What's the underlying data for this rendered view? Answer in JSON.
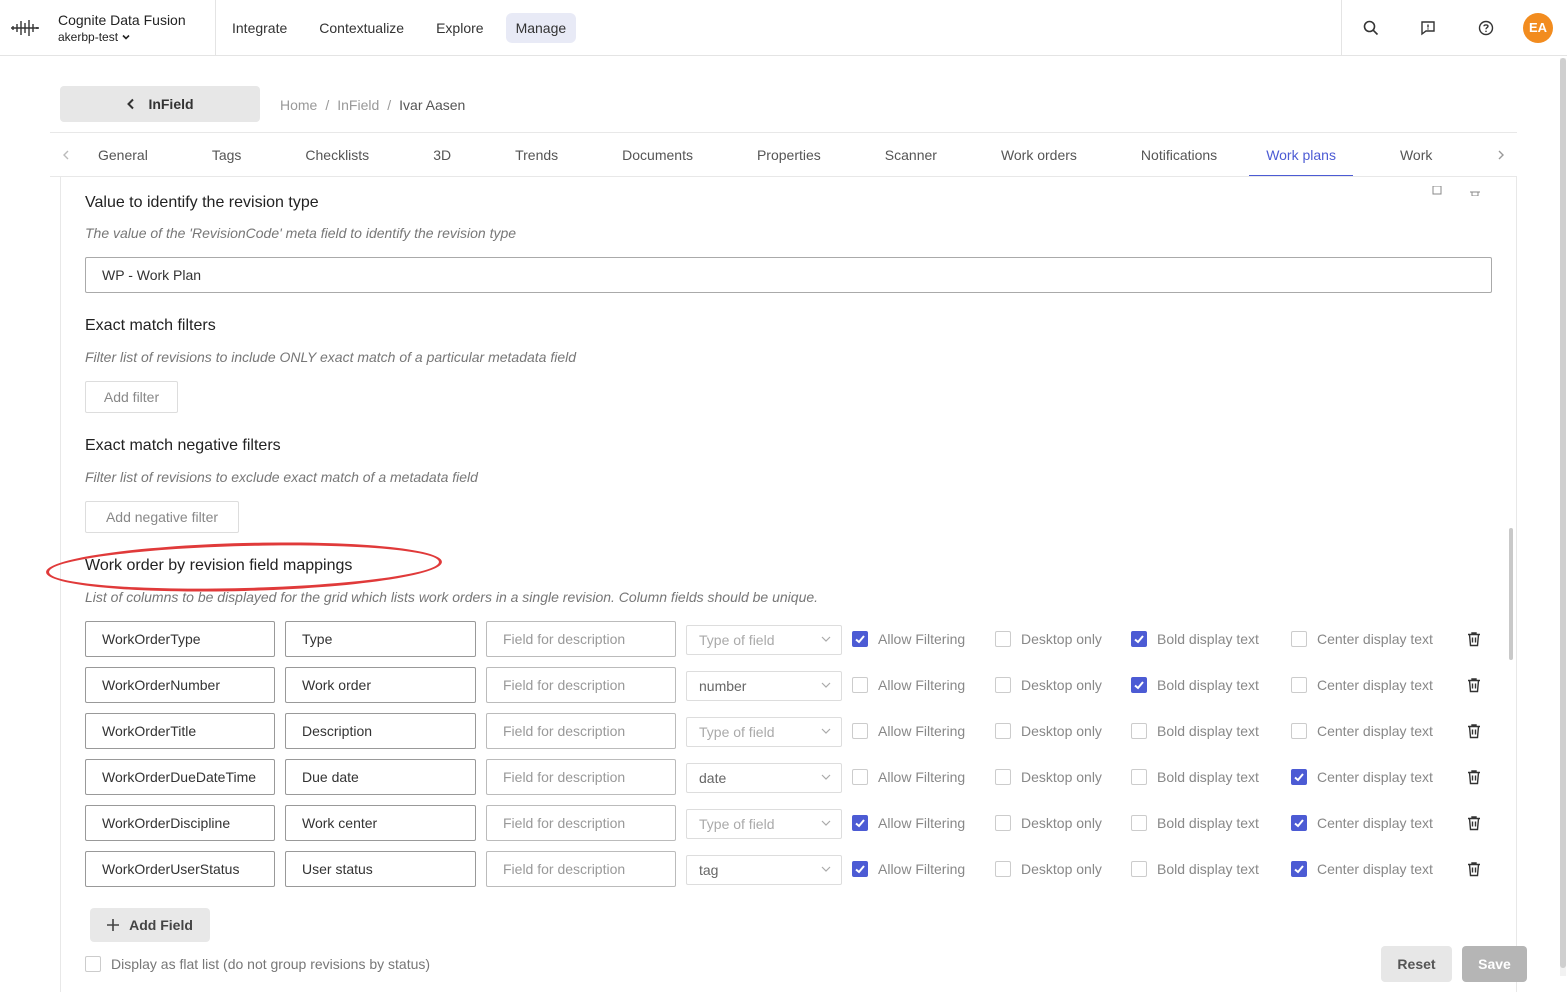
{
  "app": {
    "title": "Cognite Data Fusion",
    "project": "akerbp-test"
  },
  "nav": {
    "items": [
      "Integrate",
      "Contextualize",
      "Explore",
      "Manage"
    ],
    "active": "Manage"
  },
  "user": {
    "initials": "EA",
    "avatar_color": "#f28c1f"
  },
  "back_button": {
    "label": "InField"
  },
  "breadcrumb": {
    "items": [
      "Home",
      "InField",
      "Ivar Aasen"
    ],
    "separator": "/"
  },
  "tabs": {
    "items": [
      "General",
      "Tags",
      "Checklists",
      "3D",
      "Trends",
      "Documents",
      "Properties",
      "Scanner",
      "Work orders",
      "Notifications",
      "Work plans",
      "Work"
    ],
    "active": "Work plans"
  },
  "revision_type": {
    "title": "Value to identify the revision type",
    "description": "The value of the 'RevisionCode' meta field to identify the revision type",
    "value": "WP - Work Plan"
  },
  "exact_match": {
    "title": "Exact match filters",
    "description": "Filter list of revisions to include ONLY exact match of a particular metadata field",
    "button": "Add filter"
  },
  "negative_match": {
    "title": "Exact match negative filters",
    "description": "Filter list of revisions to exclude exact match of a metadata field",
    "button": "Add negative filter"
  },
  "mappings": {
    "title": "Work order by revision field mappings",
    "description": "List of columns to be displayed for the grid which lists work orders in a single revision. Column fields should be unique.",
    "description_placeholder": "Field for description",
    "type_placeholder": "Type of field",
    "checkbox_labels": [
      "Allow Filtering",
      "Desktop only",
      "Bold display text",
      "Center display text"
    ],
    "rows": [
      {
        "field": "WorkOrderType",
        "label": "Type",
        "type": "",
        "allow_filtering": true,
        "desktop_only": false,
        "bold": true,
        "center": false
      },
      {
        "field": "WorkOrderNumber",
        "label": "Work order",
        "type": "number",
        "allow_filtering": false,
        "desktop_only": false,
        "bold": true,
        "center": false
      },
      {
        "field": "WorkOrderTitle",
        "label": "Description",
        "type": "",
        "allow_filtering": false,
        "desktop_only": false,
        "bold": false,
        "center": false
      },
      {
        "field": "WorkOrderDueDateTime",
        "label": "Due date",
        "type": "date",
        "allow_filtering": false,
        "desktop_only": false,
        "bold": false,
        "center": true
      },
      {
        "field": "WorkOrderDiscipline",
        "label": "Work center",
        "type": "",
        "allow_filtering": true,
        "desktop_only": false,
        "bold": false,
        "center": true
      },
      {
        "field": "WorkOrderUserStatus",
        "label": "User status",
        "type": "tag",
        "allow_filtering": true,
        "desktop_only": false,
        "bold": false,
        "center": true
      }
    ],
    "add_button": "Add Field"
  },
  "flat_list": {
    "label": "Display as flat list (do not group revisions by status)",
    "checked": false
  },
  "actions": {
    "reset": "Reset",
    "save": "Save"
  },
  "colors": {
    "accent": "#4c5bd4",
    "highlight_annotation": "#e03a3a"
  }
}
